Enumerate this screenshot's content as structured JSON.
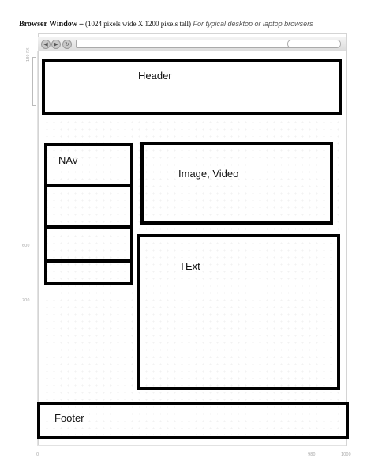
{
  "heading": {
    "bold": "Browser Window –",
    "dims": "(1024 pixels wide X 1200 pixels tall)",
    "note": "For typical desktop or laptop browsers"
  },
  "ruler": {
    "height_label": "180 PX",
    "left_mark_1": "600",
    "left_mark_2": "700",
    "bottom_left": "0",
    "bottom_mid": "980",
    "bottom_right": "1000"
  },
  "blocks": {
    "header": "Header",
    "nav": "NAv",
    "media": "Image, Video",
    "text": "TExt",
    "footer": "Footer"
  }
}
